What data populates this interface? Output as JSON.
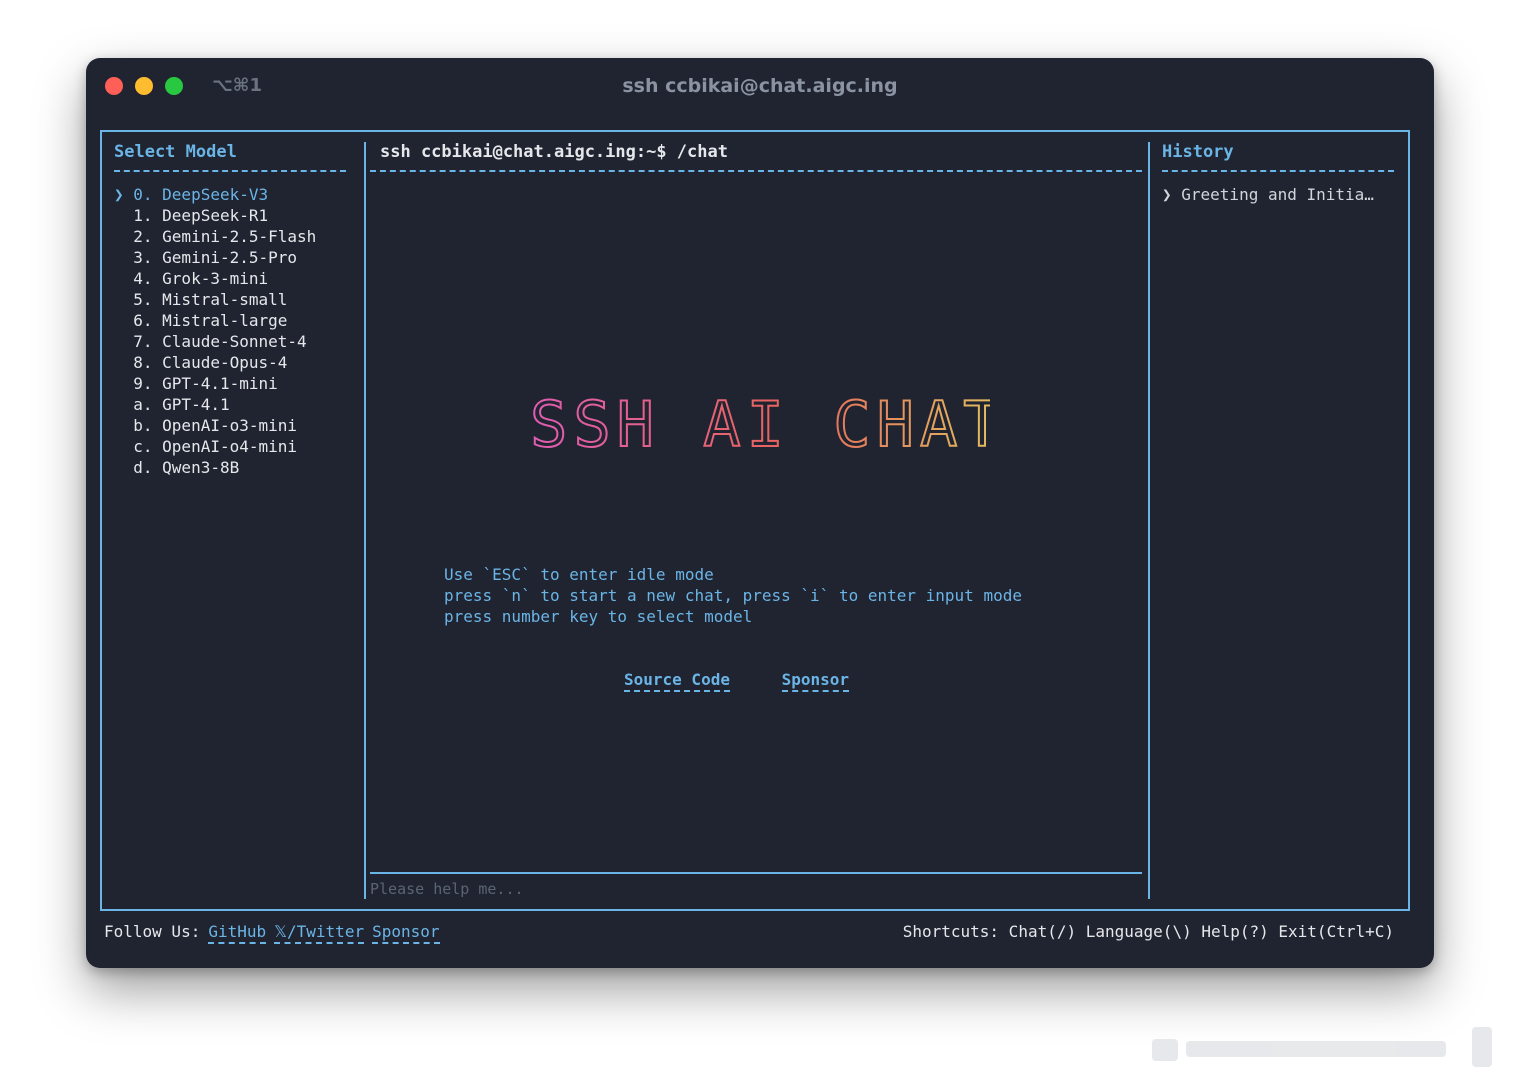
{
  "window": {
    "title": "ssh ccbikai@chat.aigc.ing",
    "tab_shortcut": "⌥⌘1"
  },
  "left_pane": {
    "title": "Select Model",
    "models": [
      {
        "label": "❯ 0. DeepSeek-V3",
        "selected": true
      },
      {
        "label": "  1. DeepSeek-R1",
        "selected": false
      },
      {
        "label": "  2. Gemini-2.5-Flash",
        "selected": false
      },
      {
        "label": "  3. Gemini-2.5-Pro",
        "selected": false
      },
      {
        "label": "  4. Grok-3-mini",
        "selected": false
      },
      {
        "label": "  5. Mistral-small",
        "selected": false
      },
      {
        "label": "  6. Mistral-large",
        "selected": false
      },
      {
        "label": "  7. Claude-Sonnet-4",
        "selected": false
      },
      {
        "label": "  8. Claude-Opus-4",
        "selected": false
      },
      {
        "label": "  9. GPT-4.1-mini",
        "selected": false
      },
      {
        "label": "  a. GPT-4.1",
        "selected": false
      },
      {
        "label": "  b. OpenAI-o3-mini",
        "selected": false
      },
      {
        "label": "  c. OpenAI-o4-mini",
        "selected": false
      },
      {
        "label": "  d. Qwen3-8B",
        "selected": false
      }
    ]
  },
  "main_pane": {
    "prompt": "ssh ccbikai@chat.aigc.ing:~$ /chat",
    "banner": {
      "text": "SSH AI CHAT",
      "gradient_start": "#e05cb3",
      "gradient_mid": "#e8655a",
      "gradient_end": "#e0c160"
    },
    "help_lines": [
      "Use `ESC` to enter idle mode",
      "press `n` to start a new chat, press `i` to enter input mode",
      "press number key to select model"
    ],
    "links": {
      "source_code": "Source Code",
      "sponsor": "Sponsor"
    },
    "input_placeholder": "Please help me..."
  },
  "right_pane": {
    "title": "History",
    "items": [
      "❯ Greeting and Initia…"
    ]
  },
  "footer": {
    "follow_label": "Follow Us:",
    "github": "GitHub",
    "twitter": "𝕏/Twitter",
    "sponsor": "Sponsor",
    "shortcuts": "Shortcuts: Chat(/) Language(\\) Help(?) Exit(Ctrl+C)"
  },
  "colors": {
    "accent": "#6bb4e6",
    "background": "#1f2430",
    "text": "#e5e7eb"
  }
}
